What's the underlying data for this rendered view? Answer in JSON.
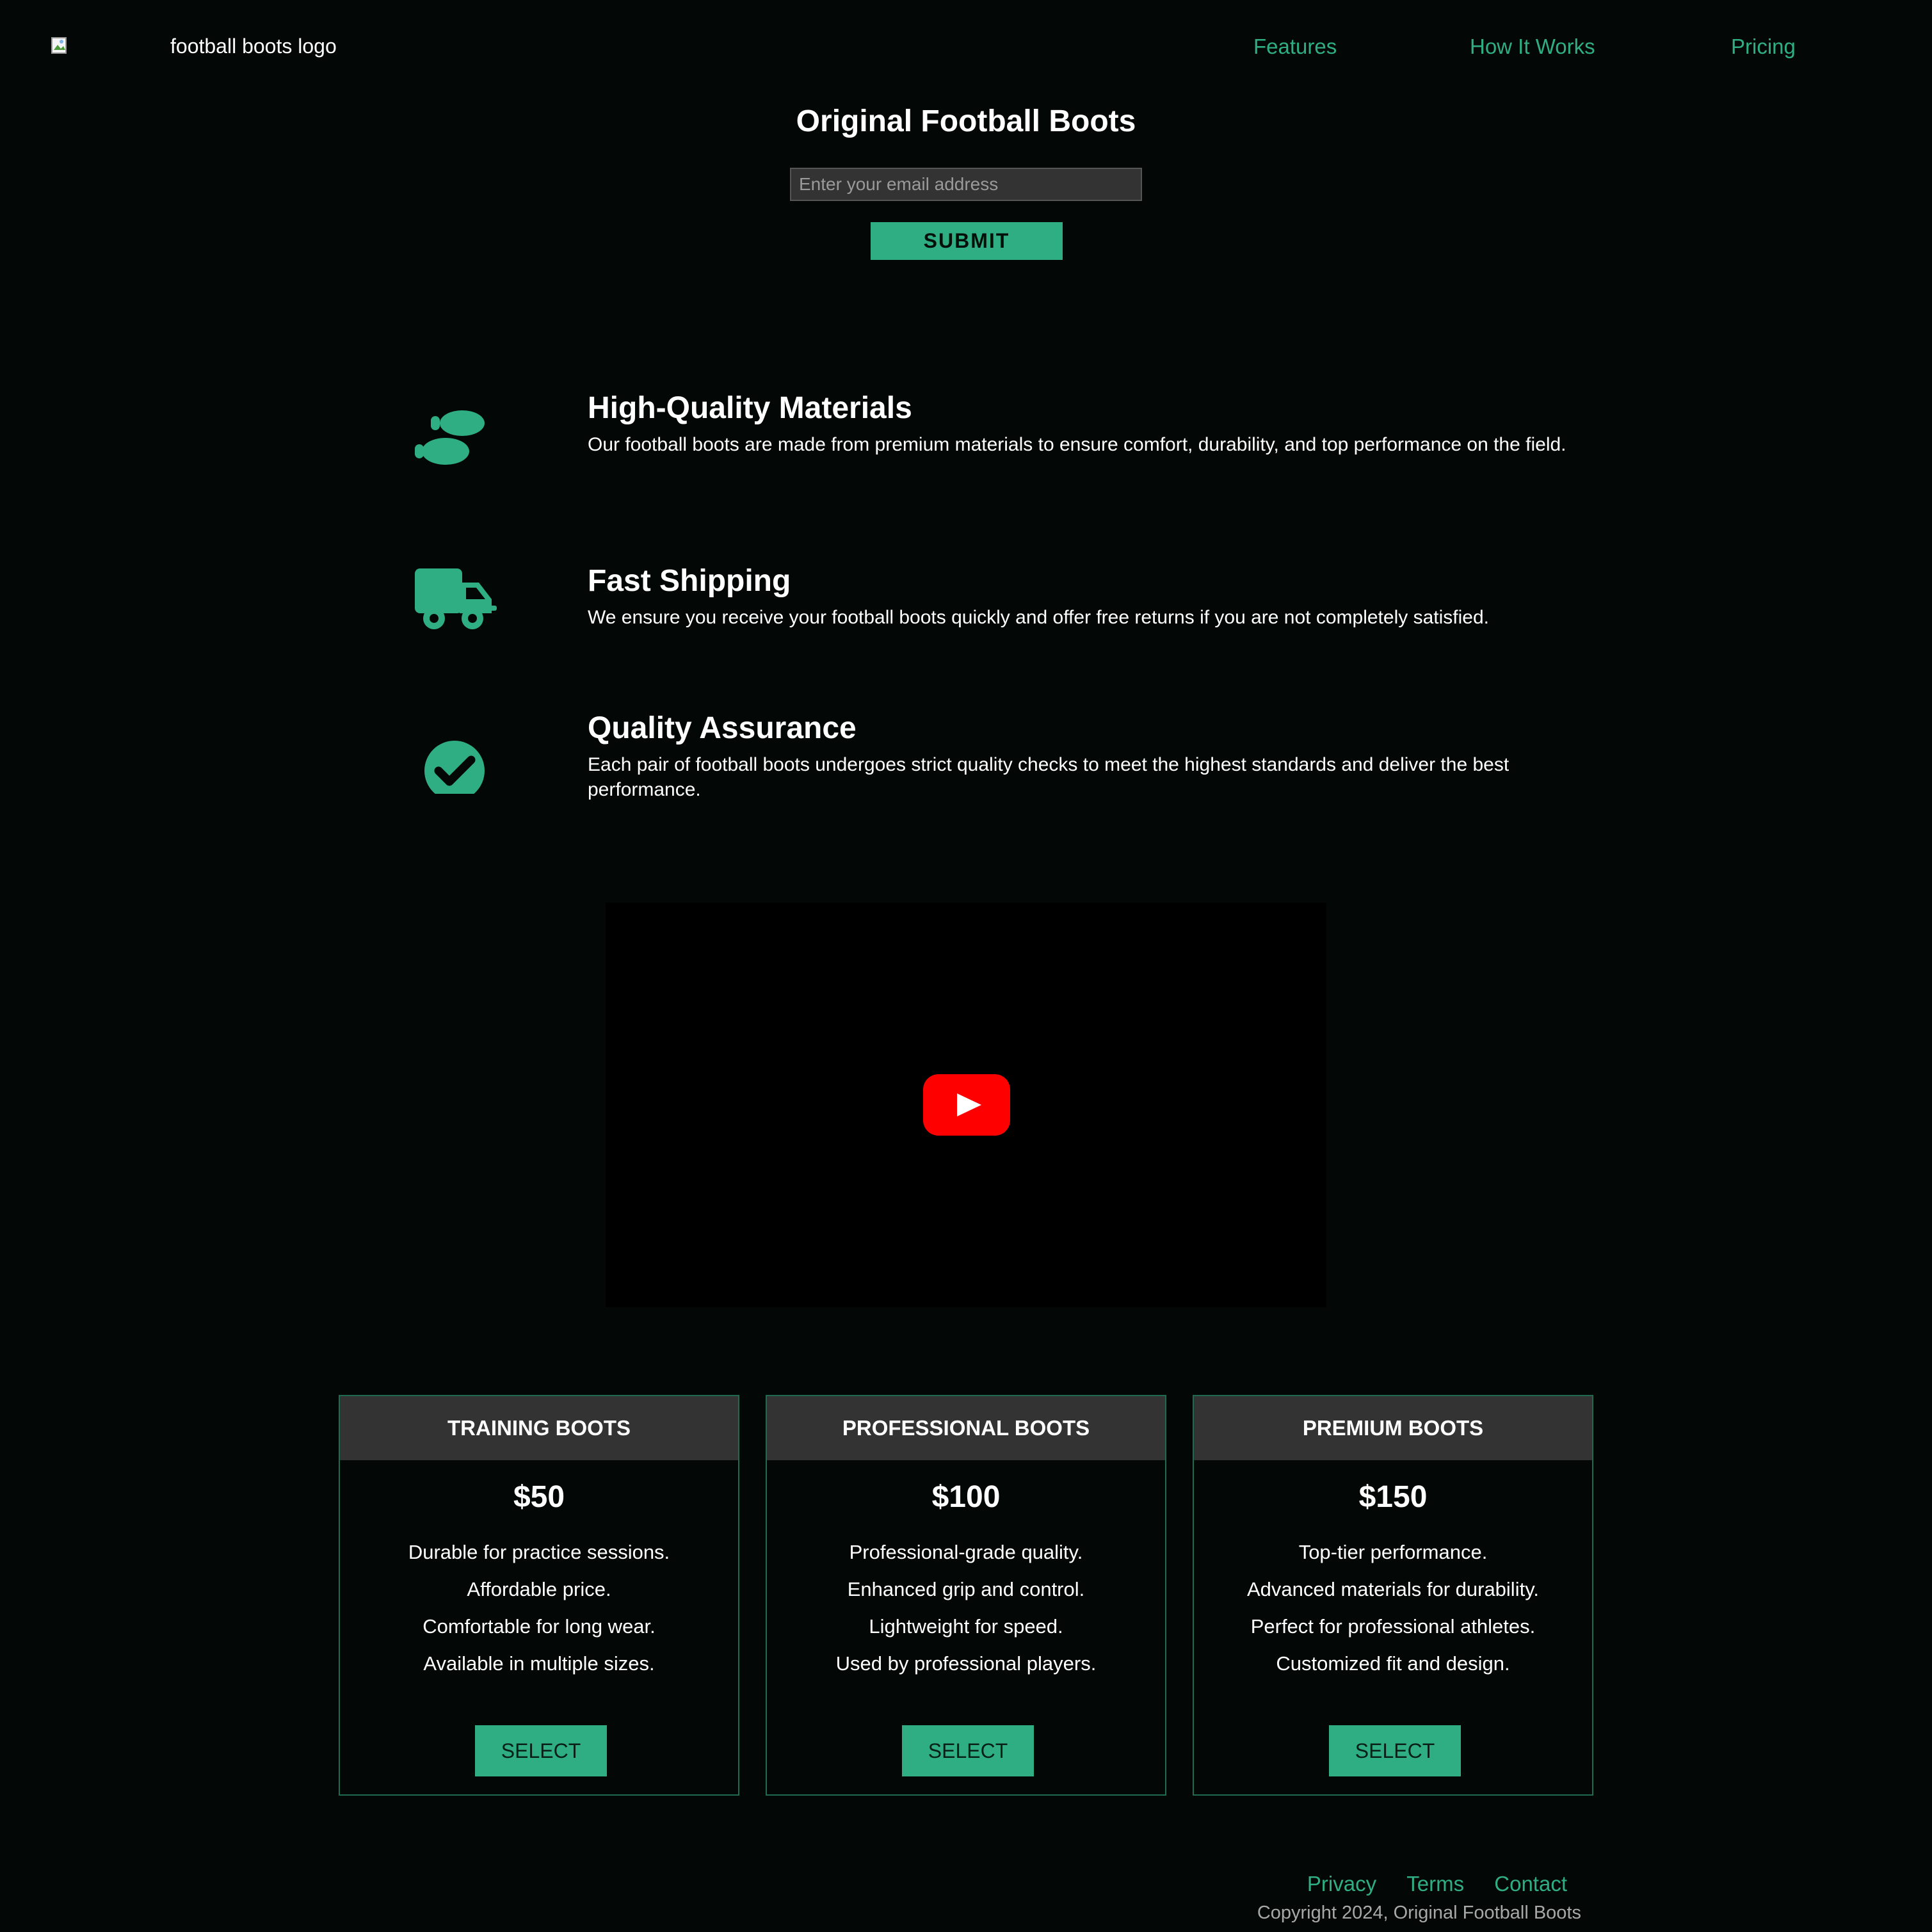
{
  "header": {
    "logo_alt": "football boots logo",
    "nav": [
      {
        "label": "Features"
      },
      {
        "label": "How It Works"
      },
      {
        "label": "Pricing"
      }
    ]
  },
  "hero": {
    "title": "Original Football Boots",
    "email_placeholder": "Enter your email address",
    "submit_label": "SUBMIT"
  },
  "features": [
    {
      "icon": "shoe-prints-icon",
      "title": "High-Quality Materials",
      "description": "Our football boots are made from premium materials to ensure comfort, durability, and top performance on the field."
    },
    {
      "icon": "truck-icon",
      "title": "Fast Shipping",
      "description": "We ensure you receive your football boots quickly and offer free returns if you are not completely satisfied."
    },
    {
      "icon": "check-circle-icon",
      "title": "Quality Assurance",
      "description": "Each pair of football boots undergoes strict quality checks to meet the highest standards and deliver the best performance."
    }
  ],
  "video": {
    "icon": "youtube-play-icon"
  },
  "plans": [
    {
      "name": "TRAINING BOOTS",
      "price": "$50",
      "features": [
        "Durable for practice sessions.",
        "Affordable price.",
        "Comfortable for long wear.",
        "Available in multiple sizes."
      ],
      "button": "SELECT"
    },
    {
      "name": "PROFESSIONAL BOOTS",
      "price": "$100",
      "features": [
        "Professional-grade quality.",
        "Enhanced grip and control.",
        "Lightweight for speed.",
        "Used by professional players."
      ],
      "button": "SELECT"
    },
    {
      "name": "PREMIUM BOOTS",
      "price": "$150",
      "features": [
        "Top-tier performance.",
        "Advanced materials for durability.",
        "Perfect for professional athletes.",
        "Customized fit and design."
      ],
      "button": "SELECT"
    }
  ],
  "footer": {
    "links": [
      {
        "label": "Privacy"
      },
      {
        "label": "Terms"
      },
      {
        "label": "Contact"
      }
    ],
    "copyright": "Copyright 2024, Original Football Boots"
  },
  "colors": {
    "background": "#030806",
    "accent": "#2fae84",
    "card_header": "#333333",
    "youtube_red": "#ff0000"
  }
}
